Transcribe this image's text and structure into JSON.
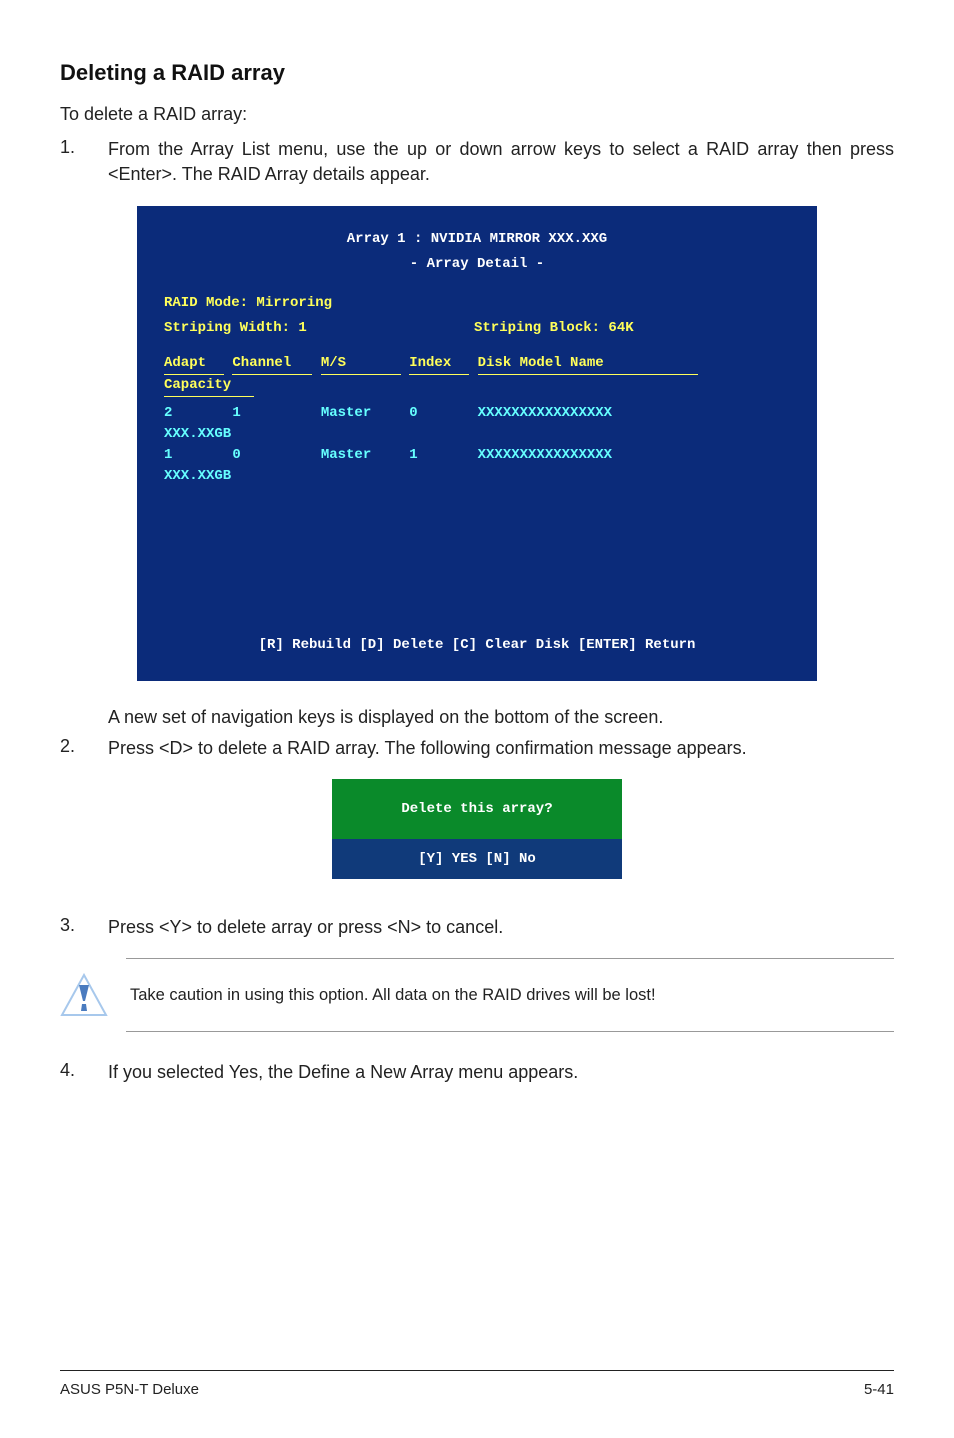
{
  "heading": "Deleting a RAID array",
  "intro": "To delete a RAID array:",
  "step1_num": "1.",
  "step1_text": "From the Array List menu, use the up or down arrow keys to select a RAID array then press <Enter>. The RAID Array details appear.",
  "bios": {
    "title": "Array 1 : NVIDIA MIRROR  XXX.XXG",
    "subtitle": "- Array Detail -",
    "mode_label": "RAID Mode: Mirroring",
    "width_label": "Striping Width: 1",
    "block_label": "Striping Block: 64K",
    "headers": {
      "adapt": "Adapt",
      "channel": "Channel",
      "ms": "M/S",
      "index": "Index",
      "model": "Disk Model Name",
      "capacity": "Capacity"
    },
    "rows": [
      {
        "adapt": "2",
        "channel": "1",
        "ms": "Master",
        "index": "0",
        "model": "XXXXXXXXXXXXXXXX",
        "capacity": "XXX.XXGB"
      },
      {
        "adapt": "1",
        "channel": "0",
        "ms": "Master",
        "index": "1",
        "model": "XXXXXXXXXXXXXXXX",
        "capacity": "XXX.XXGB"
      }
    ],
    "footer": "[R] Rebuild  [D] Delete  [C] Clear Disk  [ENTER] Return"
  },
  "after_bios": "A new set of  navigation keys is displayed on the bottom of the screen.",
  "step2_num": "2.",
  "step2_text": "Press <D> to delete a RAID array. The following confirmation message appears.",
  "confirm_top": "Delete this array?",
  "confirm_bot": "[Y] YES   [N] No",
  "step3_num": "3.",
  "step3_text": "Press <Y> to delete array or press <N> to cancel.",
  "caution_text": "Take caution in using this option. All data on the RAID drives will be lost!",
  "step4_num": "4.",
  "step4_text": "If you selected Yes, the Define a New Array menu appears.",
  "footer_left": "ASUS P5N-T Deluxe",
  "footer_right": "5-41"
}
